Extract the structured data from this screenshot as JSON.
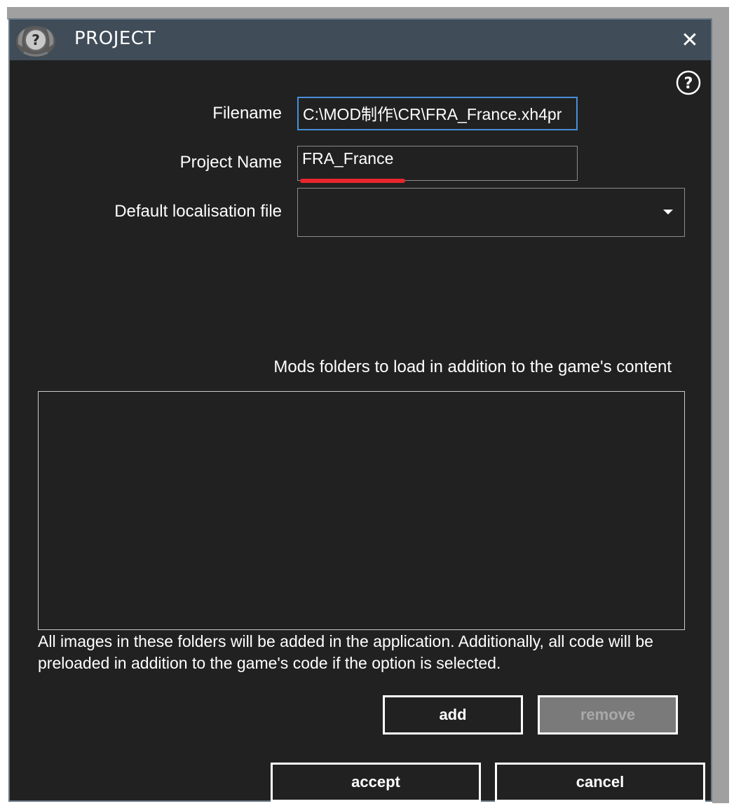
{
  "window": {
    "title": "PROJECT",
    "close_glyph": "✕",
    "logo_icon": "question-medal-icon",
    "help_glyph": "?"
  },
  "form": {
    "filename_label": "Filename",
    "filename_value": "C:\\MOD制作\\CR\\FRA_France.xh4pr",
    "project_name_label": "Project Name",
    "project_name_value": "FRA_France",
    "localisation_label": "Default localisation file",
    "localisation_value": ""
  },
  "mods": {
    "label": "Mods folders to load in addition to the game's content",
    "items": [],
    "note": "All images in these folders will be added in the application. Additionally, all code will be preloaded in addition to the game's code if the option is selected."
  },
  "buttons": {
    "add": "add",
    "remove": "remove",
    "accept": "accept",
    "cancel": "cancel"
  },
  "colors": {
    "dialog_bg": "#212121",
    "titlebar_bg": "#404c58",
    "focus_border": "#4a8fd8",
    "annotation_underline": "#e8262d",
    "disabled_button_bg": "#7a7a7a"
  }
}
